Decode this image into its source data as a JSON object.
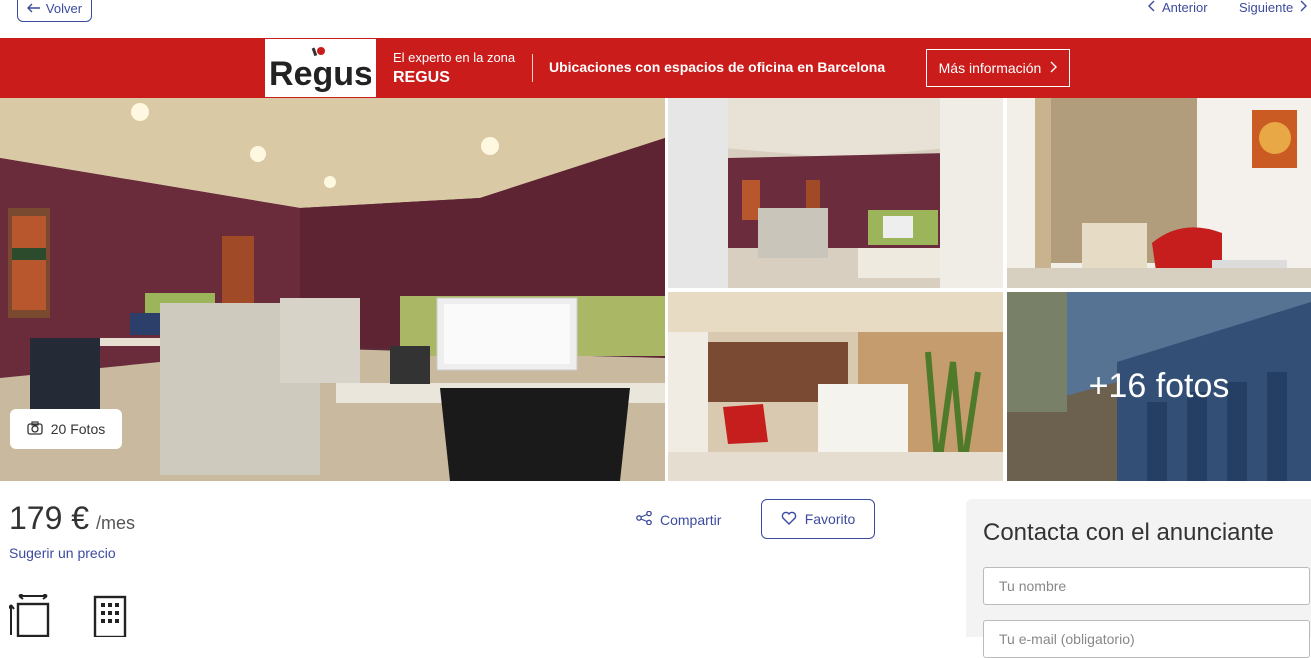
{
  "nav": {
    "back_label": "Volver",
    "prev_label": "Anterior",
    "next_label": "Siguiente"
  },
  "banner": {
    "logo_text": "Regus",
    "subtitle": "El experto en la zona",
    "advertiser": "REGUS",
    "tagline": "Ubicaciones con espacios de oficina en Barcelona",
    "more_info": "Más información",
    "bg_color": "#cb1c1c"
  },
  "gallery": {
    "photo_count_label": "20 Fotos",
    "more_photos_label": "+16 fotos"
  },
  "listing": {
    "price": "179 €",
    "price_unit": "/mes",
    "suggest_price": "Sugerir un precio",
    "share_label": "Compartir",
    "favorite_label": "Favorito"
  },
  "contact": {
    "title": "Contacta con el anunciante",
    "name_placeholder": "Tu nombre",
    "email_placeholder": "Tu e-mail (obligatorio)"
  },
  "colors": {
    "link": "#3b4b9e",
    "brand_red": "#cb1c1c"
  }
}
